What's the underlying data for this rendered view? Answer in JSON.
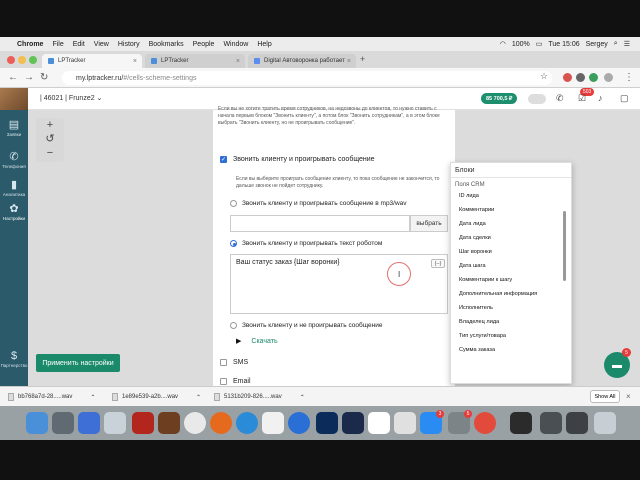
{
  "menubar": {
    "app": "Chrome",
    "items": [
      "File",
      "Edit",
      "View",
      "History",
      "Bookmarks",
      "People",
      "Window",
      "Help"
    ],
    "battery": "100%",
    "clock": "Tue 15:06",
    "user": "Sergey"
  },
  "tabs": [
    {
      "label": "LPTracker"
    },
    {
      "label": "LPTracker"
    },
    {
      "label": "Digital Автоворонка работает"
    }
  ],
  "address": {
    "host": "my.lptracker.ru/",
    "path": "#/cells-scheme-settings"
  },
  "header": {
    "account": "| 46021 | Frunze2 ⌄",
    "balance": "85 700,5 ₽",
    "notifications": "503"
  },
  "leftnav": [
    {
      "label": "Заявки",
      "icon": "leads-icon"
    },
    {
      "label": "Телефония",
      "icon": "phone-icon"
    },
    {
      "label": "Аналитика",
      "icon": "analytics-icon"
    },
    {
      "label": "Настройки",
      "icon": "settings-icon"
    },
    {
      "label": "Партнерство",
      "icon": "dollar-icon"
    }
  ],
  "zoom": {
    "plus": "+",
    "reset": "↺",
    "minus": "−"
  },
  "apply_button": "Применить настройки",
  "panel": {
    "top_note": "Если вы не хотите тратить время сотрудников, на недозвоны до клиентов, то нужно ставить с начала первым блоком \"Звонить клиенту\", а потом блок \"Звонить сотрудникам\", а в этом блоке выбрать \"Звонить клиенту, но не проигрывать сообщение\".",
    "call_client_label": "Звонить клиенту и проигрывать сообщение",
    "call_note": "Если вы выберите проиграть сообщение клиенту, то пока сообщение не закончится, то дальше звонок не пойдет сотруднику.",
    "opt_mp3": "Звонить клиенту и проигрывать сообщение в mp3/wav",
    "choose_btn": "выбрать",
    "opt_robot": "Звонить клиенту и проигрывать текст роботом",
    "robot_text": "Ваш статус заказ {Шаг воронки}",
    "vars_btn": "{--}",
    "opt_silent": "Звонить клиенту и не проигрывать сообщение",
    "listen": "Скачать",
    "sms": "SMS",
    "email": "Email"
  },
  "blocks": {
    "title": "Блоки",
    "group": "Поля CRM",
    "options": [
      "ID лида",
      "Комментарии",
      "Дата лида",
      "Дата сделки",
      "Шаг воронки",
      "Дата шага",
      "Комментарии к шагу",
      "Дополнительная информация",
      "Исполнитель",
      "Владелец лида",
      "Тип услуги/товара",
      "Сумма заказа"
    ]
  },
  "chat_badge": "5",
  "downloads": [
    {
      "name": "bb768a7d-28.....wav"
    },
    {
      "name": "1e89e539-a2b....wav"
    },
    {
      "name": "5131b209-826.....wav"
    }
  ],
  "show_all": "Show All",
  "dock_badges": [
    "3",
    "5"
  ],
  "colors": {
    "accent": "#1b8a6b",
    "nav": "#2b5a6a",
    "link": "#2f6fd6"
  }
}
